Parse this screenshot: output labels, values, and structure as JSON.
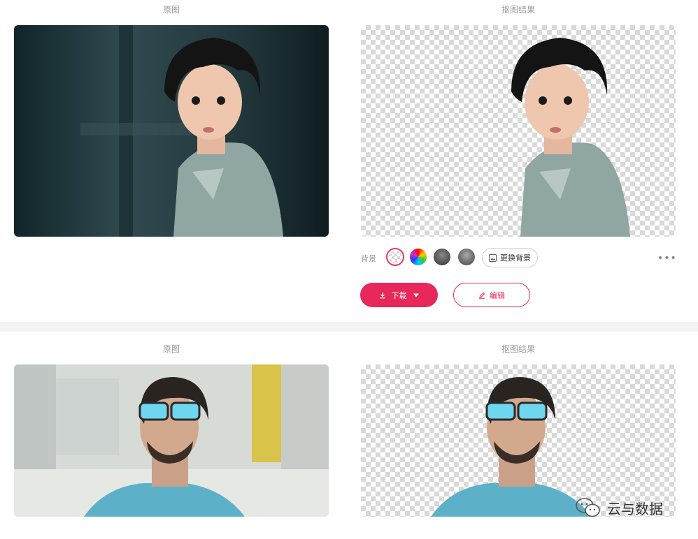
{
  "section1": {
    "original_caption": "原图",
    "result_caption": "抠图结果"
  },
  "toolbar": {
    "background_label": "背景",
    "swatches": [
      "transparent-swatch",
      "color-wheel-swatch",
      "image-swatch-1",
      "image-swatch-2"
    ],
    "change_background_label": "更换背景",
    "more_label": "•••"
  },
  "actions": {
    "download_label": "下载",
    "edit_label": "编辑"
  },
  "section2": {
    "original_caption": "原图",
    "result_caption": "抠图结果"
  },
  "watermark": {
    "text": "云与数据"
  },
  "colors": {
    "accent": "#e8285a",
    "divider": "#f3f3f3"
  }
}
